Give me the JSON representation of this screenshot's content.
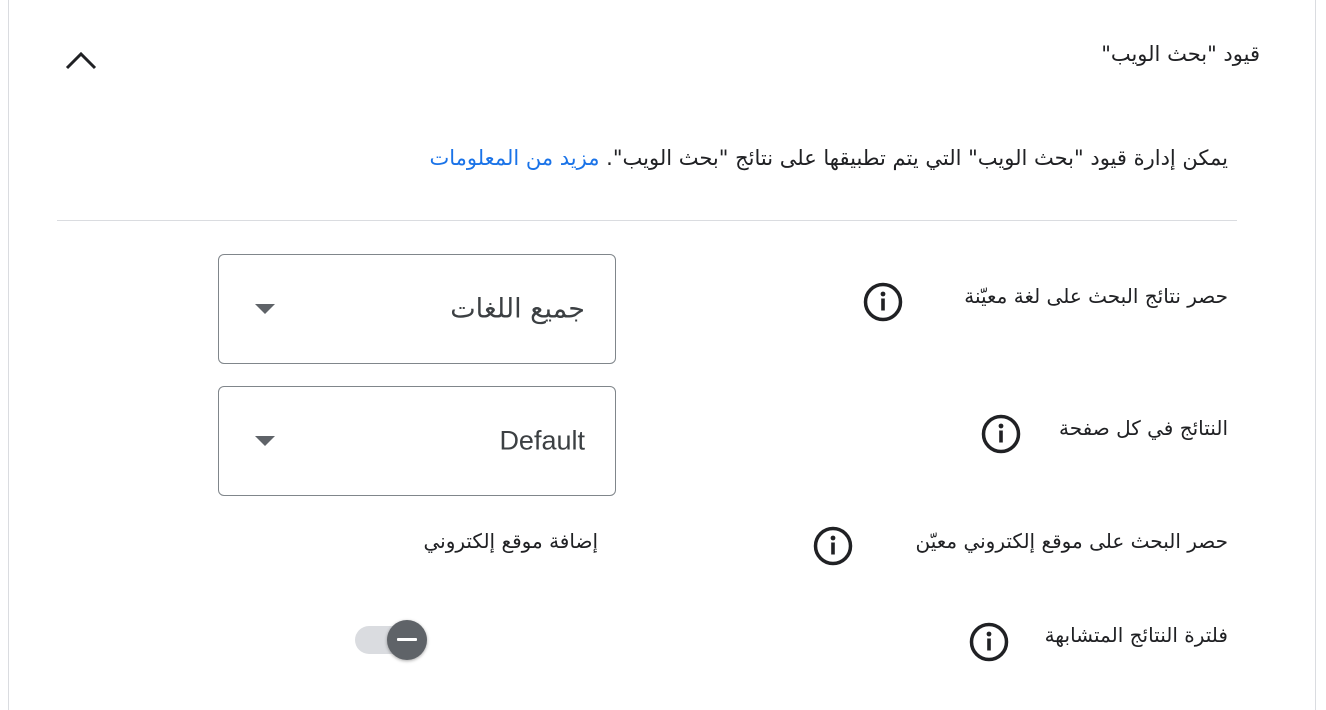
{
  "section": {
    "title": "قيود \"بحث الويب\"",
    "collapse_icon": "chevron-up-icon"
  },
  "description": {
    "text": "يمكن إدارة قيود \"بحث الويب\" التي يتم تطبيقها على نتائج \"بحث الويب\".",
    "link": "مزيد من المعلومات",
    "link_color": "#1a73e8"
  },
  "rows": {
    "language": {
      "label": "حصر نتائج البحث على لغة معيّنة",
      "value": "جميع اللغات"
    },
    "results_per_page": {
      "label": "النتائج في كل صفحة",
      "value": "Default"
    },
    "site_restrict": {
      "label": "حصر البحث على موقع إلكتروني معيّن",
      "action": "إضافة موقع إلكتروني"
    },
    "duplicate_filter": {
      "label": "فلترة النتائج المتشابهة",
      "state": "indeterminate"
    }
  },
  "info_icon": "info-icon"
}
